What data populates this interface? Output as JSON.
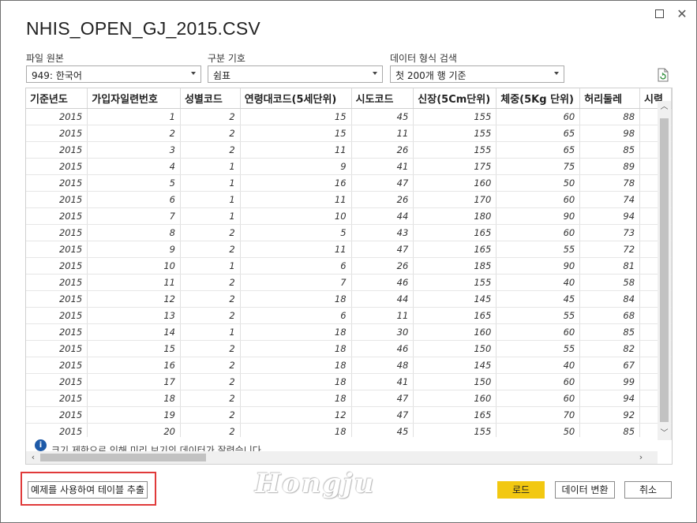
{
  "window": {
    "title": "NHIS_OPEN_GJ_2015.CSV"
  },
  "file_origin": {
    "label": "파일 원본",
    "value": "949: 한국어"
  },
  "delimiter": {
    "label": "구분 기호",
    "value": "쉼표"
  },
  "detection": {
    "label": "데이터 형식 검색",
    "value": "첫 200개 행 기준"
  },
  "table": {
    "columns": [
      "기준년도",
      "가입자일련번호",
      "성별코드",
      "연령대코드(5세단위)",
      "시도코드",
      "신장(5Cm단위)",
      "체중(5Kg 단위)",
      "허리둘레",
      "시력"
    ],
    "rows": [
      [
        "2015",
        "1",
        "2",
        "15",
        "45",
        "155",
        "60",
        "88"
      ],
      [
        "2015",
        "2",
        "2",
        "15",
        "11",
        "155",
        "65",
        "98"
      ],
      [
        "2015",
        "3",
        "2",
        "11",
        "26",
        "155",
        "65",
        "85"
      ],
      [
        "2015",
        "4",
        "1",
        "9",
        "41",
        "175",
        "75",
        "89"
      ],
      [
        "2015",
        "5",
        "1",
        "16",
        "47",
        "160",
        "50",
        "78"
      ],
      [
        "2015",
        "6",
        "1",
        "11",
        "26",
        "170",
        "60",
        "74"
      ],
      [
        "2015",
        "7",
        "1",
        "10",
        "44",
        "180",
        "90",
        "94"
      ],
      [
        "2015",
        "8",
        "2",
        "5",
        "43",
        "165",
        "60",
        "73"
      ],
      [
        "2015",
        "9",
        "2",
        "11",
        "47",
        "165",
        "55",
        "72"
      ],
      [
        "2015",
        "10",
        "1",
        "6",
        "26",
        "185",
        "90",
        "81"
      ],
      [
        "2015",
        "11",
        "2",
        "7",
        "46",
        "155",
        "40",
        "58"
      ],
      [
        "2015",
        "12",
        "2",
        "18",
        "44",
        "145",
        "45",
        "84"
      ],
      [
        "2015",
        "13",
        "2",
        "6",
        "11",
        "165",
        "55",
        "68"
      ],
      [
        "2015",
        "14",
        "1",
        "18",
        "30",
        "160",
        "60",
        "85"
      ],
      [
        "2015",
        "15",
        "2",
        "18",
        "46",
        "150",
        "55",
        "82"
      ],
      [
        "2015",
        "16",
        "2",
        "18",
        "48",
        "145",
        "40",
        "67"
      ],
      [
        "2015",
        "17",
        "2",
        "18",
        "41",
        "150",
        "60",
        "99"
      ],
      [
        "2015",
        "18",
        "2",
        "18",
        "47",
        "160",
        "60",
        "94"
      ],
      [
        "2015",
        "19",
        "2",
        "12",
        "47",
        "165",
        "70",
        "92"
      ],
      [
        "2015",
        "20",
        "2",
        "18",
        "45",
        "155",
        "50",
        "85"
      ]
    ]
  },
  "info": {
    "text": "크기 제한으로 인해 미리 보기의 데이터가 잘렸습니다."
  },
  "buttons": {
    "extract": "예제를 사용하여 테이블 추출",
    "load": "로드",
    "transform": "데이터 변환",
    "cancel": "취소"
  },
  "watermark": "Hongju",
  "colors": {
    "load_button": "#f2c811",
    "highlight_border": "#e03a3a",
    "info_icon": "#1e5aa8"
  }
}
